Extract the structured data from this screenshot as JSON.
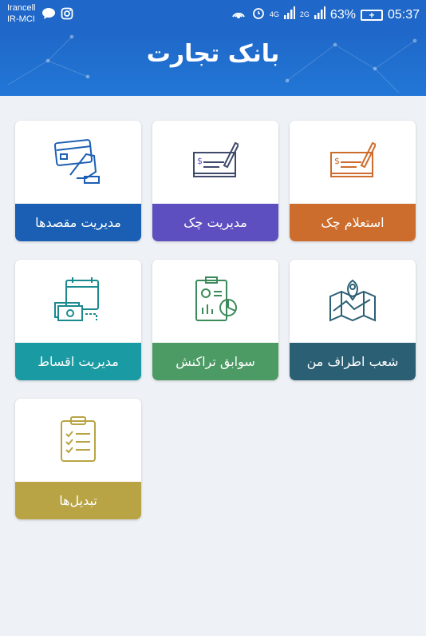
{
  "status_bar": {
    "carrier_line1": "Irancell",
    "carrier_line2": "IR-MCI",
    "network_4g": "4G",
    "network_2g": "2G",
    "battery_percent": "63%",
    "time": "05:37"
  },
  "header": {
    "logo_text": "بانک تجارت"
  },
  "tiles": [
    {
      "label": "استعلام چک",
      "icon": "cheque-pen-icon",
      "color": "#cc6d2d"
    },
    {
      "label": "مدیریت چک",
      "icon": "cheque-pen-icon",
      "color": "#5d4fbf"
    },
    {
      "label": "مدیریت مقصدها",
      "icon": "card-in-hand-icon",
      "color": "#1b5fb4"
    },
    {
      "label": "شعب اطراف من",
      "icon": "map-pin-icon",
      "color": "#2b5f74"
    },
    {
      "label": "سوابق تراکنش",
      "icon": "report-chart-icon",
      "color": "#4c9a64"
    },
    {
      "label": "مدیریت اقساط",
      "icon": "calendar-money-icon",
      "color": "#1a9aa2"
    },
    {
      "label": "تبدیل‌ها",
      "icon": "clipboard-checklist-icon",
      "color": "#b8a445"
    }
  ]
}
